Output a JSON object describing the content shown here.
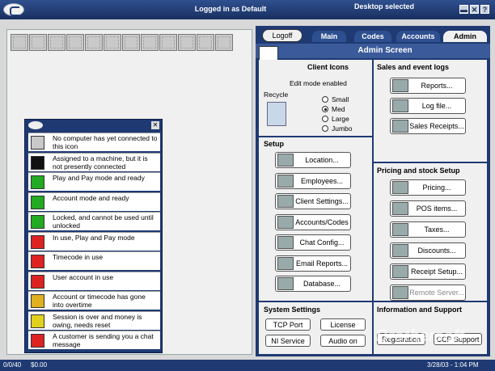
{
  "titlebar": {
    "login_text": "Logged in as Default",
    "desktop_text": "Desktop selected",
    "minimize": "▬",
    "close": "✕",
    "help": "?"
  },
  "stations": {
    "slot_count": 12
  },
  "legend": {
    "close": "✕",
    "items": [
      {
        "color": "#c8c8c8",
        "text": "No computer has yet connected to this icon"
      },
      {
        "color": "#111111",
        "text": "Assigned to a machine, but it is not presently connected"
      },
      {
        "color": "#22aa22",
        "text": "Play and Pay mode and ready"
      },
      {
        "color": "#22aa22",
        "text": "Account mode and ready"
      },
      {
        "color": "#22aa22",
        "text": "Locked, and cannot be used until unlocked"
      },
      {
        "color": "#dd2222",
        "text": "In use, Play and Pay mode"
      },
      {
        "color": "#dd2222",
        "text": "Timecode in use"
      },
      {
        "color": "#dd2222",
        "text": "User account in use"
      },
      {
        "color": "#e0b020",
        "text": "Account or timecode has gone into overtime"
      },
      {
        "color": "#e0d020",
        "text": "Session is over and money is owing, needs reset"
      },
      {
        "color": "#dd2222",
        "text": "A customer is sending you a chat message"
      }
    ]
  },
  "tabs": {
    "logoff": "Logoff",
    "main": "Main",
    "codes": "Codes",
    "accounts": "Accounts",
    "admin": "Admin"
  },
  "admin": {
    "header": "Admin Screen",
    "client_icons": {
      "title": "Client Icons",
      "edit_mode": "Edit mode enabled",
      "recycle": "Recycle",
      "sizes": [
        "Small",
        "Med",
        "Large",
        "Jumbo"
      ],
      "selected": "Med"
    },
    "setup": {
      "title": "Setup",
      "buttons": [
        "Location...",
        "Employees...",
        "Client Settings...",
        "Accounts/Codes",
        "Chat Config...",
        "Email Reports...",
        "Database..."
      ]
    },
    "system_settings": {
      "title": "System Settings",
      "buttons": [
        "TCP Port",
        "License",
        "NI Service",
        "Audio on"
      ]
    },
    "sales": {
      "title": "Sales and event logs",
      "buttons": [
        "Reports...",
        "Log file...",
        "Sales Receipts..."
      ]
    },
    "pricing": {
      "title": "Pricing and stock Setup",
      "buttons": [
        "Pricing...",
        "POS items...",
        "Taxes...",
        "Discounts...",
        "Receipt Setup...",
        "Remote Server..."
      ]
    },
    "info": {
      "title": "Information and Support",
      "buttons": [
        "Registration",
        "CCP Support"
      ]
    }
  },
  "statusbar": {
    "count": "0/0/40",
    "money": "$0.00",
    "datetime": "3/28/03 - 1:04 PM"
  },
  "watermark": "Brothersoft"
}
